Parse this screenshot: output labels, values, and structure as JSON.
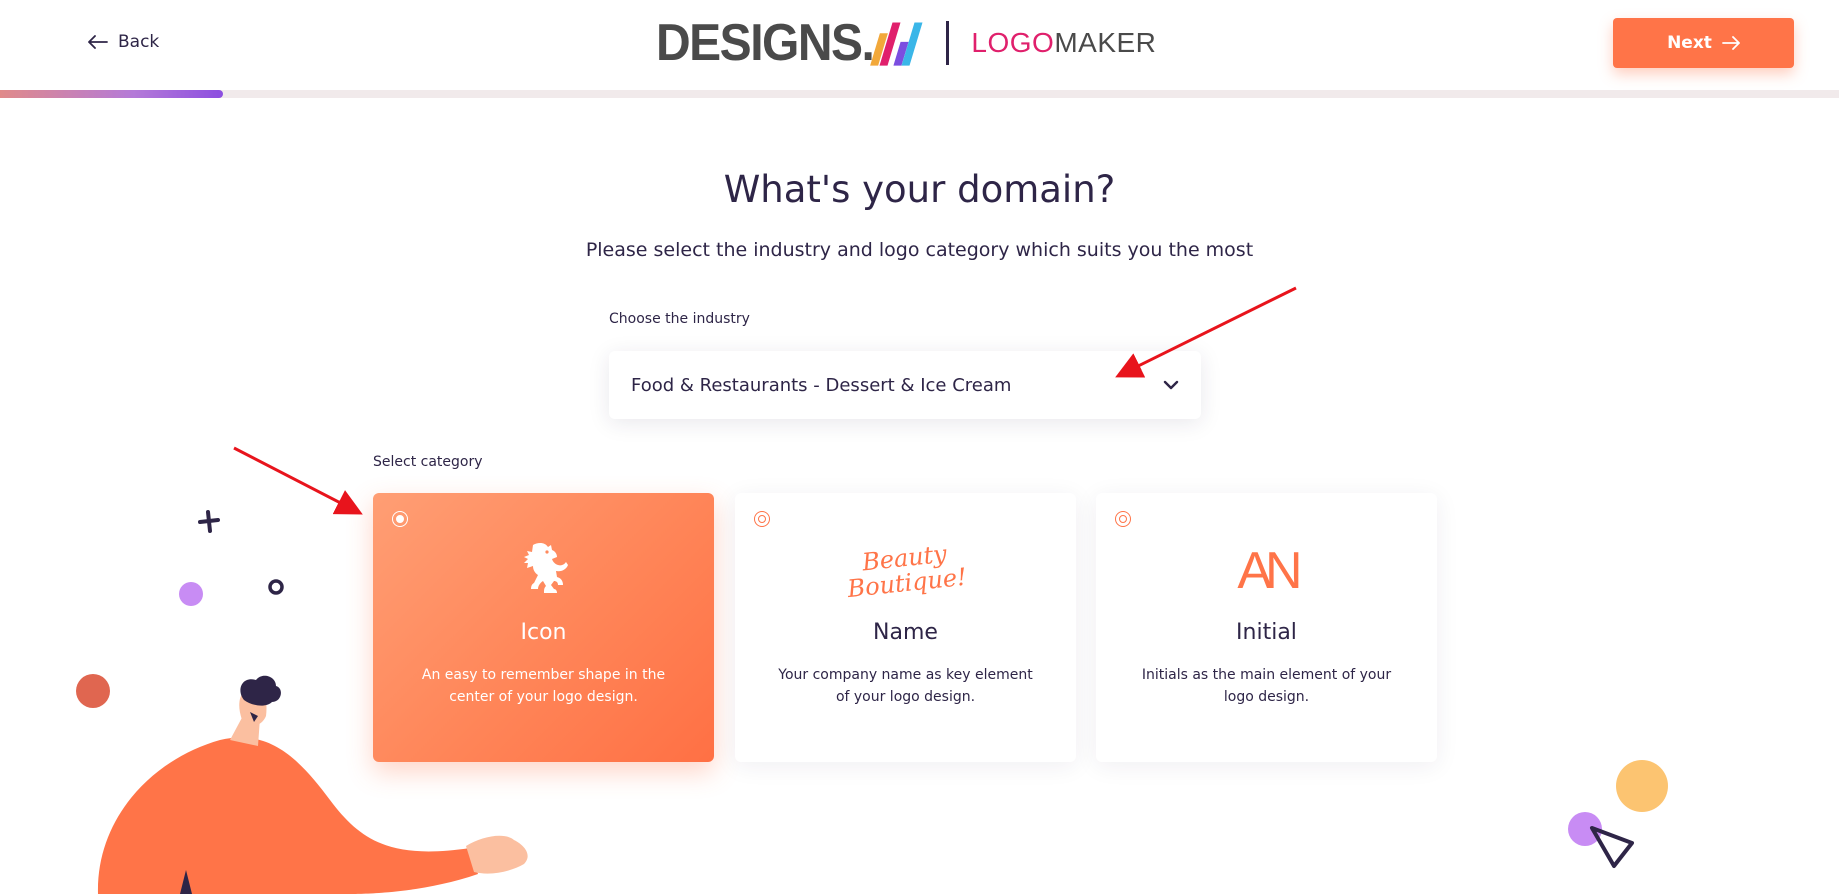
{
  "header": {
    "back_label": "Back",
    "brand_designs": "DESIGNS.",
    "brand_logo": "LOGO",
    "brand_maker": "MAKER",
    "next_label": "Next"
  },
  "progress": {
    "fraction": 0.121
  },
  "main": {
    "title": "What's your domain?",
    "subtitle": "Please select the industry and logo category which suits you the most",
    "industry_label": "Choose the industry",
    "industry_value": "Food & Restaurants - Dessert & Ice Cream",
    "category_label": "Select category"
  },
  "categories": [
    {
      "name": "Icon",
      "description": "An easy to remember shape in the center of your logo design.",
      "selected": true
    },
    {
      "name": "Name",
      "description": "Your company name as key element of your logo design.",
      "art_line1": "Beauty",
      "art_line2": "Boutique!",
      "selected": false
    },
    {
      "name": "Initial",
      "description": "Initials as the main element of your logo design.",
      "art": "AN",
      "selected": false
    }
  ],
  "colors": {
    "accent": "#ff7448",
    "text": "#2e2547",
    "brand_pink": "#e0206c",
    "annotation": "#e8141c"
  },
  "icons": [
    "arrow-left-icon",
    "arrow-right-icon",
    "chevron-down-icon",
    "lion-icon"
  ]
}
